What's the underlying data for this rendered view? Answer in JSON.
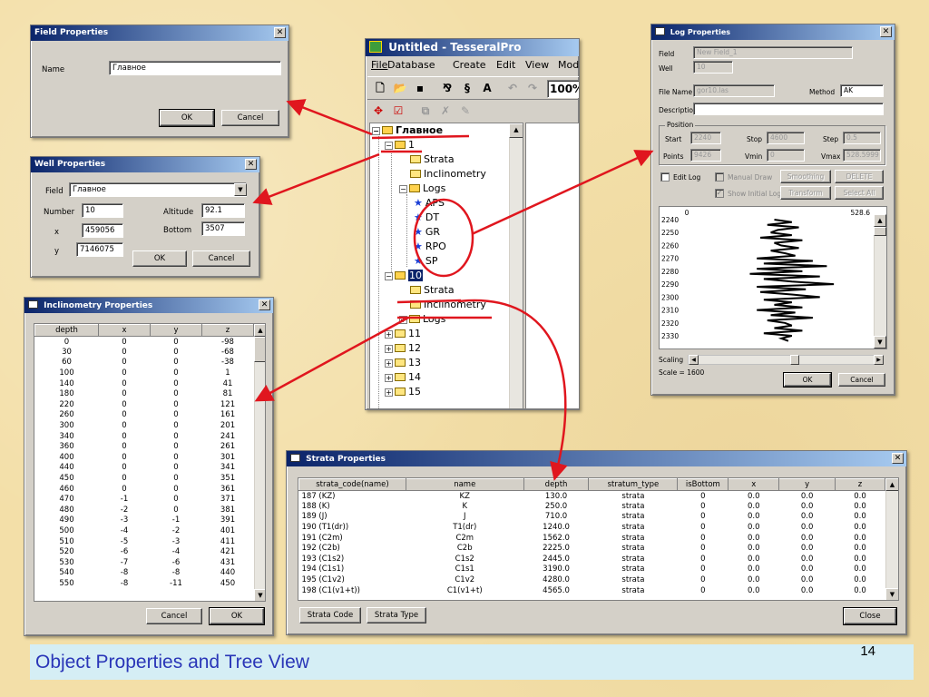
{
  "slide": {
    "title": "Object Properties and Tree View",
    "page_number": "14"
  },
  "field_dialog": {
    "title": "Field Properties",
    "name_label": "Name",
    "name_value": "Главное",
    "ok": "OK",
    "cancel": "Cancel"
  },
  "well_dialog": {
    "title": "Well Properties",
    "field_label": "Field",
    "field_value": "Главное",
    "number_label": "Number",
    "number_value": "10",
    "altitude_label": "Altitude",
    "altitude_value": "92.1",
    "x_label": "x",
    "x_value": "459056",
    "bottom_label": "Bottom",
    "bottom_value": "3507",
    "y_label": "y",
    "y_value": "7146075",
    "ok": "OK",
    "cancel": "Cancel"
  },
  "incl_dialog": {
    "title": "Inclinometry Properties",
    "columns": [
      "depth",
      "x",
      "y",
      "z"
    ],
    "rows": [
      [
        "0",
        "0",
        "0",
        "-98"
      ],
      [
        "30",
        "0",
        "0",
        "-68"
      ],
      [
        "60",
        "0",
        "0",
        "-38"
      ],
      [
        "100",
        "0",
        "0",
        "1"
      ],
      [
        "140",
        "0",
        "0",
        "41"
      ],
      [
        "180",
        "0",
        "0",
        "81"
      ],
      [
        "220",
        "0",
        "0",
        "121"
      ],
      [
        "260",
        "0",
        "0",
        "161"
      ],
      [
        "300",
        "0",
        "0",
        "201"
      ],
      [
        "340",
        "0",
        "0",
        "241"
      ],
      [
        "360",
        "0",
        "0",
        "261"
      ],
      [
        "400",
        "0",
        "0",
        "301"
      ],
      [
        "440",
        "0",
        "0",
        "341"
      ],
      [
        "450",
        "0",
        "0",
        "351"
      ],
      [
        "460",
        "0",
        "0",
        "361"
      ],
      [
        "470",
        "-1",
        "0",
        "371"
      ],
      [
        "480",
        "-2",
        "0",
        "381"
      ],
      [
        "490",
        "-3",
        "-1",
        "391"
      ],
      [
        "500",
        "-4",
        "-2",
        "401"
      ],
      [
        "510",
        "-5",
        "-3",
        "411"
      ],
      [
        "520",
        "-6",
        "-4",
        "421"
      ],
      [
        "530",
        "-7",
        "-6",
        "431"
      ],
      [
        "540",
        "-8",
        "-8",
        "440"
      ],
      [
        "550",
        "-8",
        "-11",
        "450"
      ]
    ],
    "cancel": "Cancel",
    "ok": "OK"
  },
  "main_window": {
    "title": "Untitled - TesseralPro",
    "menu": [
      "File",
      "Database",
      "Create",
      "Edit",
      "View",
      "Mod"
    ],
    "zoom": "100%",
    "tree": {
      "root": "Главное",
      "well1": "1",
      "strata": "Strata",
      "inclinometry": "Inclinometry",
      "logs": "Logs",
      "log_items": [
        "APS",
        "DT",
        "GR",
        "RPO",
        "SP"
      ],
      "well10": "10",
      "strata2": "Strata",
      "inclinometry2": "Inclinometry",
      "logs2": "Logs",
      "other_wells": [
        "11",
        "12",
        "13",
        "14",
        "15"
      ]
    }
  },
  "log_dialog": {
    "title": "Log Properties",
    "field_label": "Field",
    "field_value": "New Field_1",
    "well_label": "Well",
    "well_value": "10",
    "filename_label": "File Name",
    "filename_value": "gor10.las",
    "method_label": "Method",
    "method_value": "AK",
    "description_label": "Description",
    "description_value": "",
    "position_group": "Position",
    "start_label": "Start",
    "start_value": "2240",
    "stop_label": "Stop",
    "stop_value": "4600",
    "step_label": "Step",
    "step_value": "0.5",
    "points_label": "Points",
    "points_value": "9426",
    "vmin_label": "Vmin",
    "vmin_value": "0",
    "vmax_label": "Vmax",
    "vmax_value": "528.5999",
    "edit_log": "Edit Log",
    "manual_draw": "Manual Draw",
    "smoothing": "Smoothing",
    "delete": "DELETE",
    "show_initial_log": "Show Initial Log",
    "transform": "Transform",
    "select_all": "Select All",
    "scaling_label": "Scaling",
    "scale_text": "Scale = 1600",
    "ok": "OK",
    "cancel": "Cancel"
  },
  "chart_data": {
    "type": "line",
    "x_axis_ticks": [
      "0",
      "528.6"
    ],
    "xlim": [
      0,
      528.6
    ],
    "y_axis_ticks": [
      "2240",
      "2250",
      "2260",
      "2270",
      "2280",
      "2290",
      "2300",
      "2310",
      "2320",
      "2330"
    ],
    "ylim": [
      2240,
      2337
    ],
    "grid": false,
    "series": [
      {
        "depth": [
          2240,
          2242,
          2244,
          2246,
          2248,
          2250,
          2252,
          2254,
          2256,
          2258,
          2260,
          2262,
          2264,
          2266,
          2268,
          2270,
          2272,
          2274,
          2276,
          2278,
          2280,
          2282,
          2284,
          2286,
          2288,
          2290,
          2292,
          2294,
          2296,
          2298,
          2300,
          2302,
          2304,
          2306,
          2308,
          2310,
          2312,
          2314,
          2316,
          2318,
          2320,
          2322,
          2324,
          2326,
          2328,
          2330,
          2332,
          2334
        ],
        "values": [
          250,
          300,
          230,
          320,
          260,
          240,
          300,
          210,
          330,
          250,
          270,
          320,
          240,
          280,
          310,
          200,
          360,
          220,
          400,
          200,
          330,
          180,
          380,
          220,
          300,
          420,
          200,
          340,
          210,
          300,
          380,
          220,
          300,
          250,
          330,
          200,
          310,
          240,
          360,
          230,
          280,
          300,
          250,
          330,
          220,
          300,
          270,
          290
        ]
      }
    ]
  },
  "strata_dialog": {
    "title": "Strata Properties",
    "columns": [
      "strata_code(name)",
      "name",
      "depth",
      "stratum_type",
      "isBottom",
      "x",
      "y",
      "z"
    ],
    "rows": [
      [
        "187 (KZ)",
        "KZ",
        "130.0",
        "strata",
        "0",
        "0.0",
        "0.0",
        "0.0"
      ],
      [
        "188 (K)",
        "K",
        "250.0",
        "strata",
        "0",
        "0.0",
        "0.0",
        "0.0"
      ],
      [
        "189 (J)",
        "J",
        "710.0",
        "strata",
        "0",
        "0.0",
        "0.0",
        "0.0"
      ],
      [
        "190 (T1(dr))",
        "T1(dr)",
        "1240.0",
        "strata",
        "0",
        "0.0",
        "0.0",
        "0.0"
      ],
      [
        "191 (C2m)",
        "C2m",
        "1562.0",
        "strata",
        "0",
        "0.0",
        "0.0",
        "0.0"
      ],
      [
        "192 (C2b)",
        "C2b",
        "2225.0",
        "strata",
        "0",
        "0.0",
        "0.0",
        "0.0"
      ],
      [
        "193 (C1s2)",
        "C1s2",
        "2445.0",
        "strata",
        "0",
        "0.0",
        "0.0",
        "0.0"
      ],
      [
        "194 (C1s1)",
        "C1s1",
        "3190.0",
        "strata",
        "0",
        "0.0",
        "0.0",
        "0.0"
      ],
      [
        "195 (C1v2)",
        "C1v2",
        "4280.0",
        "strata",
        "0",
        "0.0",
        "0.0",
        "0.0"
      ],
      [
        "198 (C1(v1+t))",
        "C1(v1+t)",
        "4565.0",
        "strata",
        "0",
        "0.0",
        "0.0",
        "0.0"
      ]
    ],
    "strata_code_btn": "Strata Code",
    "strata_type_btn": "Strata Type",
    "close": "Close"
  },
  "colors": {
    "background": "#f3dfa8",
    "title_bar": "#0a246a",
    "footer_band": "#d5eef5",
    "footer_text": "#2a36b8",
    "annotation": "#e0161e"
  }
}
